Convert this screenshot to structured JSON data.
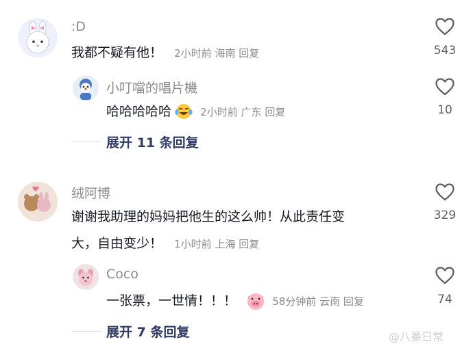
{
  "comments": [
    {
      "user": ":D",
      "text": "我都不疑有他！",
      "time": "2小时前",
      "location": "海南",
      "reply": "回复",
      "likes": "543"
    },
    {
      "user": "小叮噹的唱片機",
      "text": "哈哈哈哈哈",
      "time": "2小时前",
      "location": "广东",
      "reply": "回复",
      "likes": "10"
    },
    {
      "user": "绒阿博",
      "text_line1": "谢谢我助理的妈妈把他生的这么帅！从此责任变",
      "text_line2": "大，自由变少！",
      "time": "1小时前",
      "location": "上海",
      "reply": "回复",
      "likes": "329"
    },
    {
      "user": "Coco",
      "text": "一张票，一世情！！！",
      "time": "58分钟前",
      "location": "云南",
      "reply": "回复",
      "likes": "74"
    }
  ],
  "expand": [
    {
      "label": "展开 11 条回复"
    },
    {
      "label": "展开 7 条回复"
    }
  ],
  "watermark": {
    "text": "@八番日常"
  },
  "icons": {
    "heart": "heart-outline-icon",
    "laugh": "laughing-crying-emoji-icon",
    "pig": "pig-face-emoji-icon"
  },
  "colors": {
    "text": "#161823",
    "muted": "#8a8b91",
    "expand": "#2f3a66"
  }
}
